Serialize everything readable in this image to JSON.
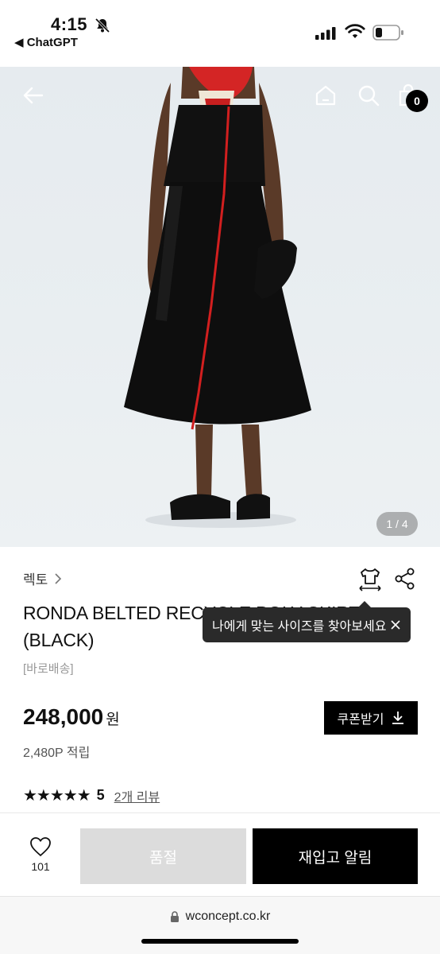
{
  "status_bar": {
    "time": "4:15",
    "back_app": "◀ ChatGPT"
  },
  "gallery": {
    "pager": "1 / 4",
    "cart_count": "0"
  },
  "product": {
    "brand": "렉토",
    "title": "RONDA BELTED RECYCLE POLY SKIRT (BLACK)",
    "delivery": "[바로배송]",
    "price": "248,000",
    "price_unit": "원",
    "points": "2,480P 적립",
    "rating_stars": "★★★★★",
    "rating_value": "5",
    "review_link": "2개 리뷰"
  },
  "tooltip": {
    "text": "나에게 맞는 사이즈를 찾아보세요"
  },
  "buttons": {
    "coupon": "쿠폰받기",
    "soldout": "품절",
    "restock": "재입고 알림",
    "like_count": "101"
  },
  "browser": {
    "url": "wconcept.co.kr"
  },
  "icons": [
    "bell-slash-icon",
    "signal-icon",
    "wifi-icon",
    "battery-icon",
    "back-arrow-icon",
    "home-icon",
    "search-icon",
    "bag-icon",
    "size-guide-icon",
    "share-icon",
    "close-icon",
    "download-icon",
    "heart-icon",
    "lock-icon"
  ]
}
